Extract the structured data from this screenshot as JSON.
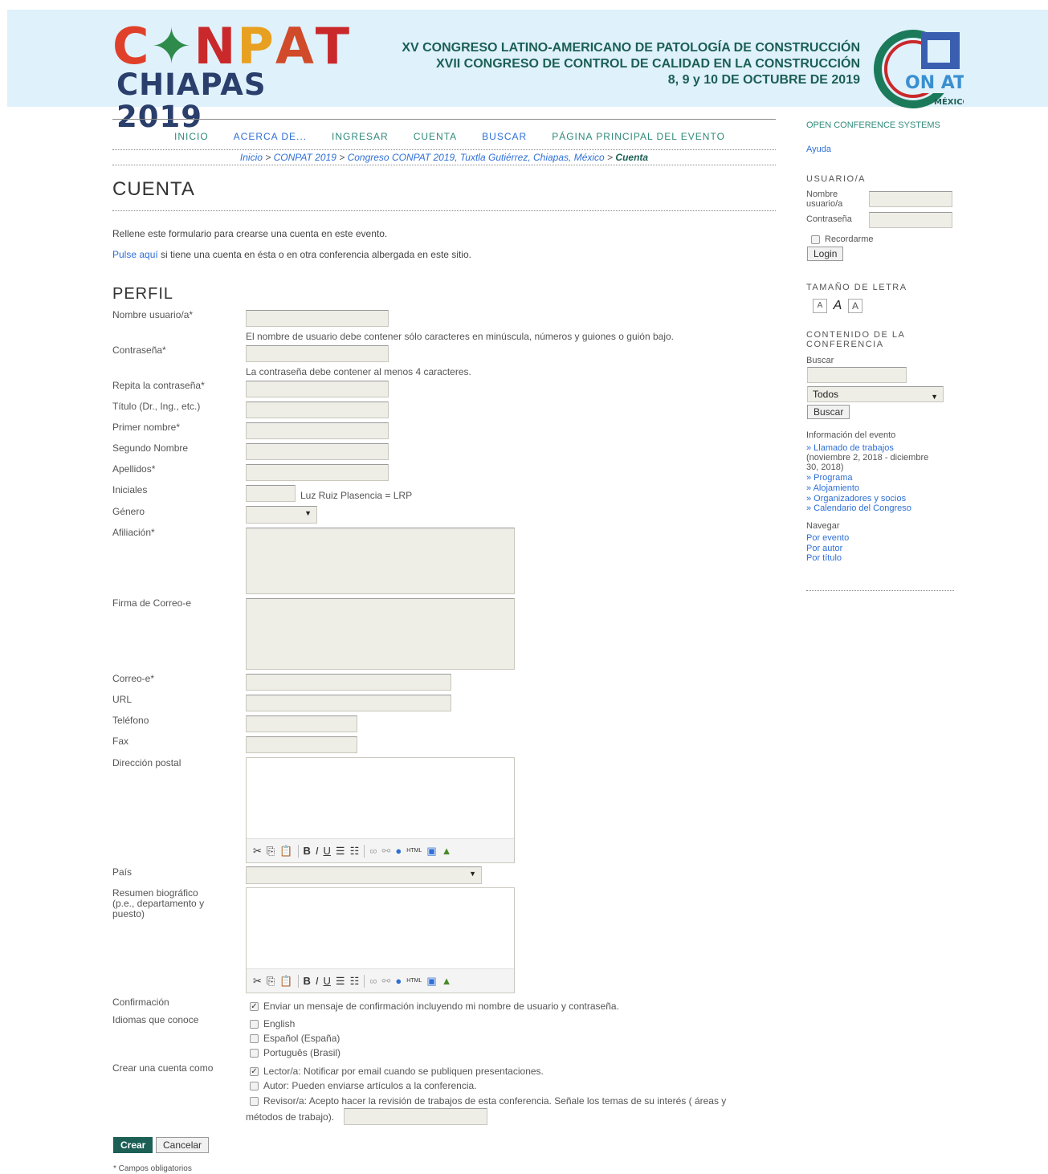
{
  "banner": {
    "logo_top": "CONPAT",
    "logo_bottom": "CHIAPAS 2019",
    "line1": "XV CONGRESO LATINO-AMERICANO DE PATOLOGÍA DE CONSTRUCCIÓN",
    "line2": "XVII CONGRESO DE CONTROL DE CALIDAD EN LA CONSTRUCCIÓN",
    "line3": "8, 9 y 10 DE OCTUBRE DE 2019",
    "right_logo_text": "ON AT",
    "right_logo_sub": "MÉXICO"
  },
  "nav": {
    "items": [
      "INICIO",
      "ACERCA DE...",
      "INGRESAR",
      "CUENTA",
      "BUSCAR",
      "PÁGINA PRINCIPAL DEL EVENTO"
    ]
  },
  "breadcrumb": {
    "items": [
      "Inicio",
      "CONPAT 2019",
      "Congreso CONPAT 2019, Tuxtla Gutiérrez, Chiapas, México"
    ],
    "separator": " > ",
    "current": "Cuenta"
  },
  "page": {
    "title": "CUENTA",
    "intro1": "Rellene este formulario para crearse una cuenta en este evento.",
    "intro2_link": "Pulse aquí",
    "intro2_rest": " si tiene una cuenta en ésta o en otra conferencia albergada en este sitio.",
    "section": "PERFIL"
  },
  "form": {
    "username_label": "Nombre usuario/a*",
    "username_hint": "El nombre de usuario debe contener sólo caracteres en minúscula, números y guiones o guión bajo.",
    "password_label": "Contraseña*",
    "password_hint": "La contraseña debe contener al menos 4 caracteres.",
    "repeat_label": "Repita la contraseña*",
    "title_label": "Título (Dr., Ing., etc.)",
    "first_label": "Primer nombre*",
    "middle_label": "Segundo Nombre",
    "last_label": "Apellidos*",
    "initials_label": "Iniciales",
    "initials_hint": "Luz Ruiz Plasencia = LRP",
    "gender_label": "Género",
    "affiliation_label": "Afiliación*",
    "signature_label": "Firma de Correo-e",
    "email_label": "Correo-e*",
    "url_label": "URL",
    "phone_label": "Teléfono",
    "fax_label": "Fax",
    "address_label": "Dirección postal",
    "country_label": "País",
    "bio_label": "Resumen biográfico (p.e., departamento y puesto)",
    "confirm_label": "Confirmación",
    "confirm_text": "Enviar un mensaje de confirmación incluyendo mi nombre de usuario y contraseña.",
    "languages_label": "Idiomas que conoce",
    "languages": [
      "English",
      "Español (España)",
      "Português (Brasil)"
    ],
    "role_label": "Crear una cuenta como",
    "role_reader": "Lector/a: Notificar por email cuando se publiquen presentaciones.",
    "role_author": "Autor: Pueden enviarse artículos a la conferencia.",
    "role_reviewer": "Revisor/a: Acepto hacer la revisión de trabajos de esta conferencia. Señale los temas de su interés ( áreas y",
    "role_reviewer_2": "métodos de trabajo).",
    "create_button": "Crear",
    "cancel_button": "Cancelar",
    "required_note": "* Campos obligatorios"
  },
  "sidebar": {
    "ocs": "OPEN CONFERENCE SYSTEMS",
    "help": "Ayuda",
    "user_heading": "USUARIO/A",
    "username_label": "Nombre usuario/a",
    "password_label": "Contraseña",
    "remember": "Recordarme",
    "login_button": "Login",
    "font_heading": "TAMAÑO DE LETRA",
    "font_small": "A",
    "font_medium": "A",
    "font_large": "A",
    "content_heading": "CONTENIDO DE LA CONFERENCIA",
    "search_label": "Buscar",
    "search_scope": "Todos",
    "search_button": "Buscar",
    "event_info": "Información del evento",
    "call_link": "» Llamado de trabajos",
    "call_dates": "(noviembre 2, 2018 - diciembre 30, 2018)",
    "program_link": "» Programa",
    "lodging_link": "» Alojamiento",
    "organizers_link": "» Organizadores y socios",
    "calendar_link": "» Calendario del Congreso",
    "browse": "Navegar",
    "by_event": "Por evento",
    "by_author": "Por autor",
    "by_title": "Por título"
  },
  "colors": {
    "accent_green": "#1b5f55",
    "link_blue": "#2f6fd6",
    "banner_bg": "#dff1fb"
  }
}
